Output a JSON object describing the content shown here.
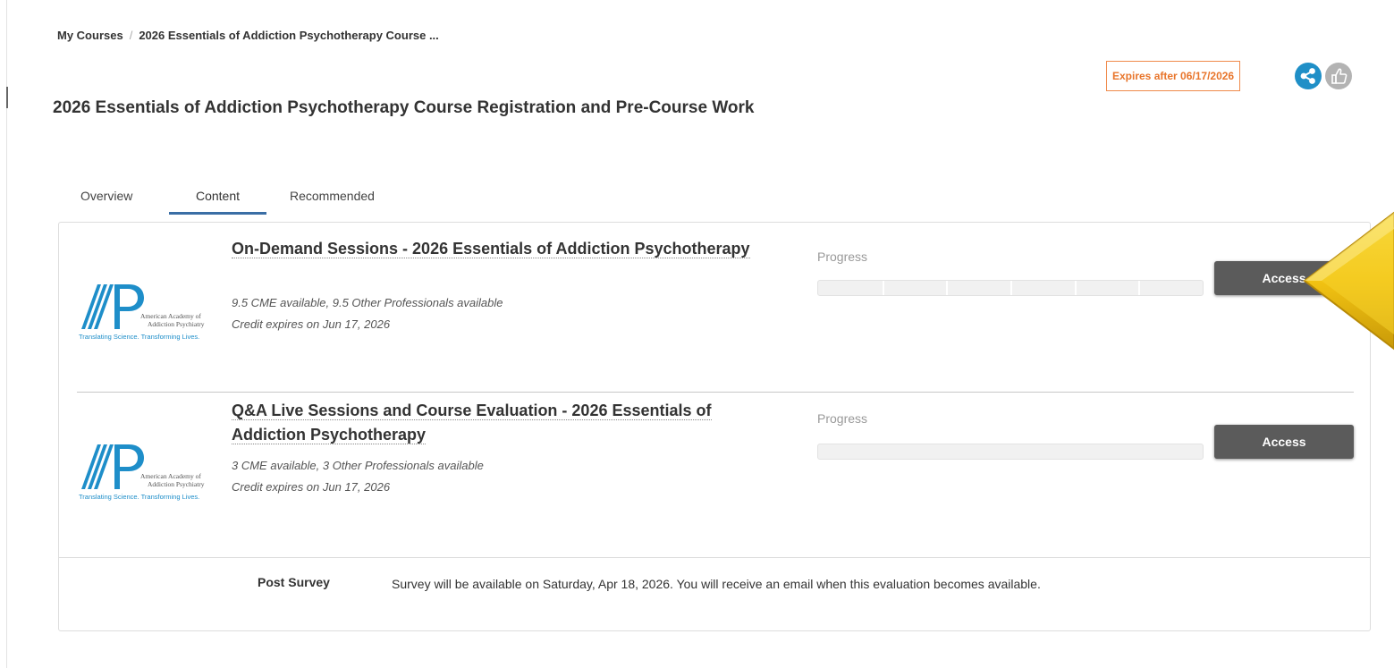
{
  "breadcrumb": {
    "root": "My Courses",
    "separator": "/",
    "current": "2026 Essentials of Addiction Psychotherapy Course ..."
  },
  "header": {
    "expires": "Expires after 06/17/2026",
    "share_icon": "share-icon",
    "like_icon": "thumbs-up-icon"
  },
  "page_title": "2026 Essentials of Addiction Psychotherapy Course Registration and Pre-Course Work",
  "tabs": [
    {
      "label": "Overview",
      "active": false
    },
    {
      "label": "Content",
      "active": true
    },
    {
      "label": "Recommended",
      "active": false
    }
  ],
  "sessions": [
    {
      "title": "On-Demand Sessions - 2026 Essentials of Addiction Psychotherapy",
      "credits": "9.5 CME available, 9.5 Other Professionals available",
      "expiry": "Credit expires on Jun 17, 2026",
      "progress_label": "Progress",
      "progress_percent": 0,
      "segment_count": 6,
      "action": "Access"
    },
    {
      "title": "Q&A Live Sessions and Course Evaluation - 2026 Essentials of Addiction Psychotherapy",
      "credits": "3 CME available, 3 Other Professionals available",
      "expiry": "Credit expires on Jun 17, 2026",
      "progress_label": "Progress",
      "progress_percent": 0,
      "segment_count": 0,
      "action": "Access"
    }
  ],
  "logo": {
    "name": "American Academy of Addiction Psychiatry",
    "line1": "American Academy of",
    "line2": "Addiction Psychiatry",
    "tagline": "Translating Science. Transforming Lives."
  },
  "post_survey": {
    "label": "Post Survey",
    "text": "Survey will be available on Saturday, Apr 18, 2026. You will receive an email when this evaluation becomes available."
  },
  "colors": {
    "accent": "#1f8fc7",
    "expires": "#e8752b",
    "button": "#5b5b5b",
    "logo": "#1e8ec9",
    "arrow": "#f2c313"
  },
  "annotation_icon": "arrow-pointer-icon"
}
